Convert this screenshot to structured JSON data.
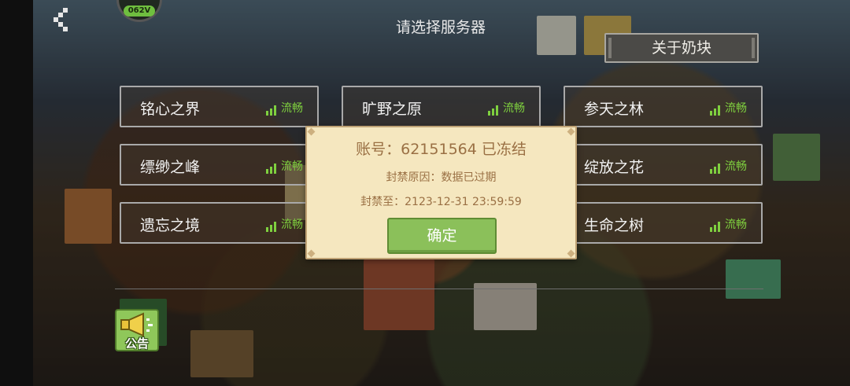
{
  "header": {
    "title": "请选择服务器",
    "about_button": "关于奶块",
    "avatar_badge": "062V"
  },
  "servers": [
    {
      "name": "铭心之界",
      "status": "流畅"
    },
    {
      "name": "旷野之原",
      "status": "流畅"
    },
    {
      "name": "参天之林",
      "status": "流畅"
    },
    {
      "name": "缥缈之峰",
      "status": "流畅"
    },
    {
      "name": "",
      "status": ""
    },
    {
      "name": "绽放之花",
      "status": "流畅"
    },
    {
      "name": "遗忘之境",
      "status": "流畅"
    },
    {
      "name": "",
      "status": ""
    },
    {
      "name": "生命之树",
      "status": "流畅"
    }
  ],
  "notice_button": "公告",
  "dialog": {
    "account_line": "账号：62151564 已冻结",
    "reason_line": "封禁原因：数据已过期",
    "until_line": "封禁至：2123-12-31 23:59:59",
    "confirm_button": "确定"
  },
  "colors": {
    "status_green": "#7fd03f",
    "dialog_bg": "#f5e7bf",
    "dialog_text": "#9a7044",
    "confirm_bg": "#8bc05a"
  },
  "icons": [
    "back-chevron-icon",
    "signal-bars-icon",
    "megaphone-icon"
  ]
}
